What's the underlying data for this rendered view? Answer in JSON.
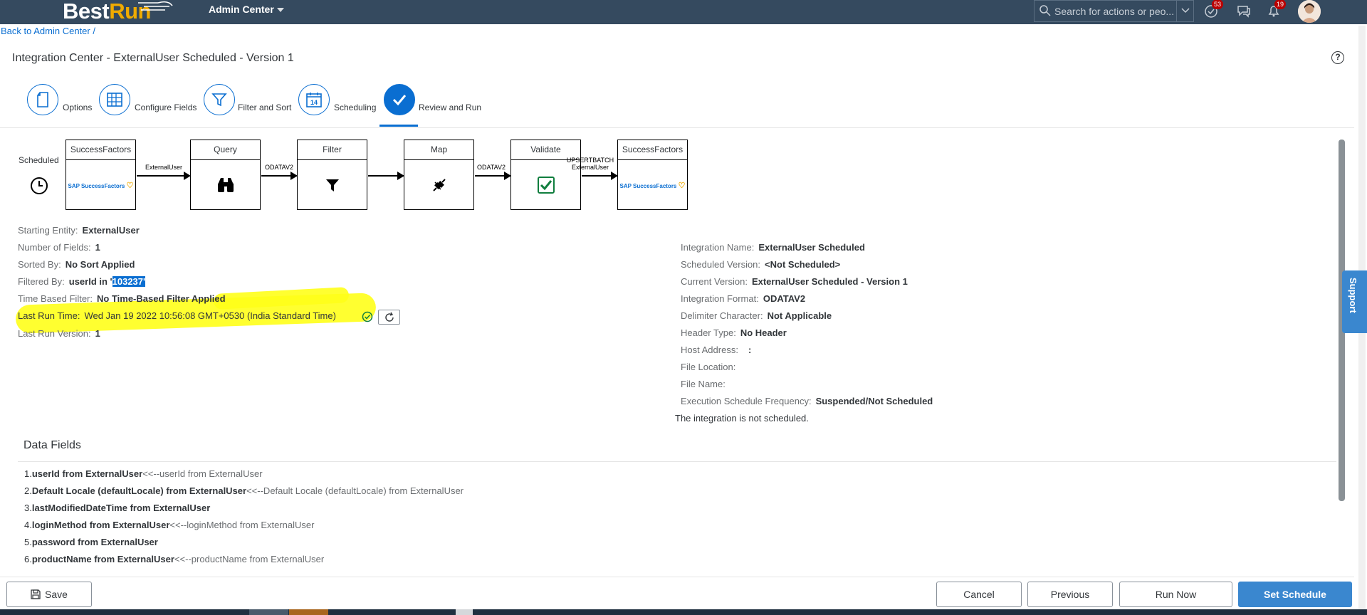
{
  "shell": {
    "logo_best": "Best",
    "logo_run": "Run",
    "module": "Admin Center",
    "search_placeholder": "Search for actions or peo...",
    "notifications_count": "53",
    "alerts_count": "19"
  },
  "breadcrumb": {
    "link": "Back to Admin Center",
    "separator": "/"
  },
  "page": {
    "title": "Integration Center - ExternalUser Scheduled - Version 1",
    "help": "?"
  },
  "wizard": {
    "steps": [
      {
        "label": "Options"
      },
      {
        "label": "Configure Fields"
      },
      {
        "label": "Filter and Sort"
      },
      {
        "label": "Scheduling",
        "icon_text": "14"
      },
      {
        "label": "Review and Run"
      }
    ]
  },
  "flow": {
    "start_label": "Scheduled",
    "nodes": [
      {
        "title": "SuccessFactors",
        "logo": "SAP SuccessFactors"
      },
      {
        "title": "Query"
      },
      {
        "title": "Filter"
      },
      {
        "title": "Map"
      },
      {
        "title": "Validate"
      },
      {
        "title": "SuccessFactors",
        "logo": "SAP SuccessFactors"
      }
    ],
    "edges": [
      {
        "label": "ExternalUser"
      },
      {
        "label": "ODATAV2"
      },
      {
        "label": ""
      },
      {
        "label": "ODATAV2"
      },
      {
        "label_line1": "UPSERTBATCH",
        "label_line2": "ExternalUser"
      }
    ]
  },
  "details_left": {
    "starting_entity": {
      "key": "Starting Entity:",
      "value": "ExternalUser"
    },
    "num_fields": {
      "key": "Number of Fields:",
      "value": "1"
    },
    "sorted_by": {
      "key": "Sorted By:",
      "value": "No Sort Applied"
    },
    "filtered_by": {
      "key": "Filtered By:",
      "value_prefix": "userId in '",
      "value_selected": "103237'"
    },
    "time_filter": {
      "key": "Time Based Filter:",
      "value": "No Time-Based Filter Applied"
    },
    "last_run_time": {
      "key": "Last Run Time:",
      "value": "Wed Jan 19 2022 10:56:08 GMT+0530 (India Standard Time)"
    },
    "last_run_version": {
      "key": "Last Run Version:",
      "value": "1"
    }
  },
  "details_right": {
    "integration_name": {
      "key": "Integration Name:",
      "value": "ExternalUser Scheduled"
    },
    "scheduled_version": {
      "key": "Scheduled Version:",
      "value": "<Not Scheduled>"
    },
    "current_version": {
      "key": "Current Version:",
      "value": "ExternalUser Scheduled - Version 1"
    },
    "integration_format": {
      "key": "Integration Format:",
      "value": "ODATAV2"
    },
    "delimiter": {
      "key": "Delimiter Character:",
      "value": "Not Applicable"
    },
    "header_type": {
      "key": "Header Type:",
      "value": "No Header"
    },
    "host_address": {
      "key": "Host Address:",
      "value": ":"
    },
    "file_location": {
      "key": "File Location:",
      "value": ""
    },
    "file_name": {
      "key": "File Name:",
      "value": ""
    },
    "exec_freq": {
      "key": "Execution Schedule Frequency:",
      "value": "Suspended/Not Scheduled"
    },
    "note": "The integration is not scheduled."
  },
  "data_fields": {
    "title": "Data Fields",
    "items": [
      {
        "num": "1.",
        "bold": "userId from ExternalUser",
        "mapping": "<<--userId from ExternalUser"
      },
      {
        "num": "2.",
        "bold": "Default Locale (defaultLocale) from ExternalUser",
        "mapping": "<<--Default Locale (defaultLocale) from ExternalUser"
      },
      {
        "num": "3.",
        "bold": "lastModifiedDateTime from ExternalUser",
        "mapping": ""
      },
      {
        "num": "4.",
        "bold": "loginMethod from ExternalUser",
        "mapping": "<<--loginMethod from ExternalUser"
      },
      {
        "num": "5.",
        "bold": "password from ExternalUser",
        "mapping": ""
      },
      {
        "num": "6.",
        "bold": "productName from ExternalUser",
        "mapping": "<<--productName from ExternalUser"
      }
    ]
  },
  "support": "Support",
  "footer": {
    "save": "Save",
    "cancel": "Cancel",
    "previous": "Previous",
    "run_now": "Run Now",
    "set_schedule": "Set Schedule"
  },
  "colors": {
    "shell": "#354a5f",
    "accent": "#0a6ed1",
    "primary_button": "#3a87cf",
    "highlight": "#ffff1a"
  }
}
